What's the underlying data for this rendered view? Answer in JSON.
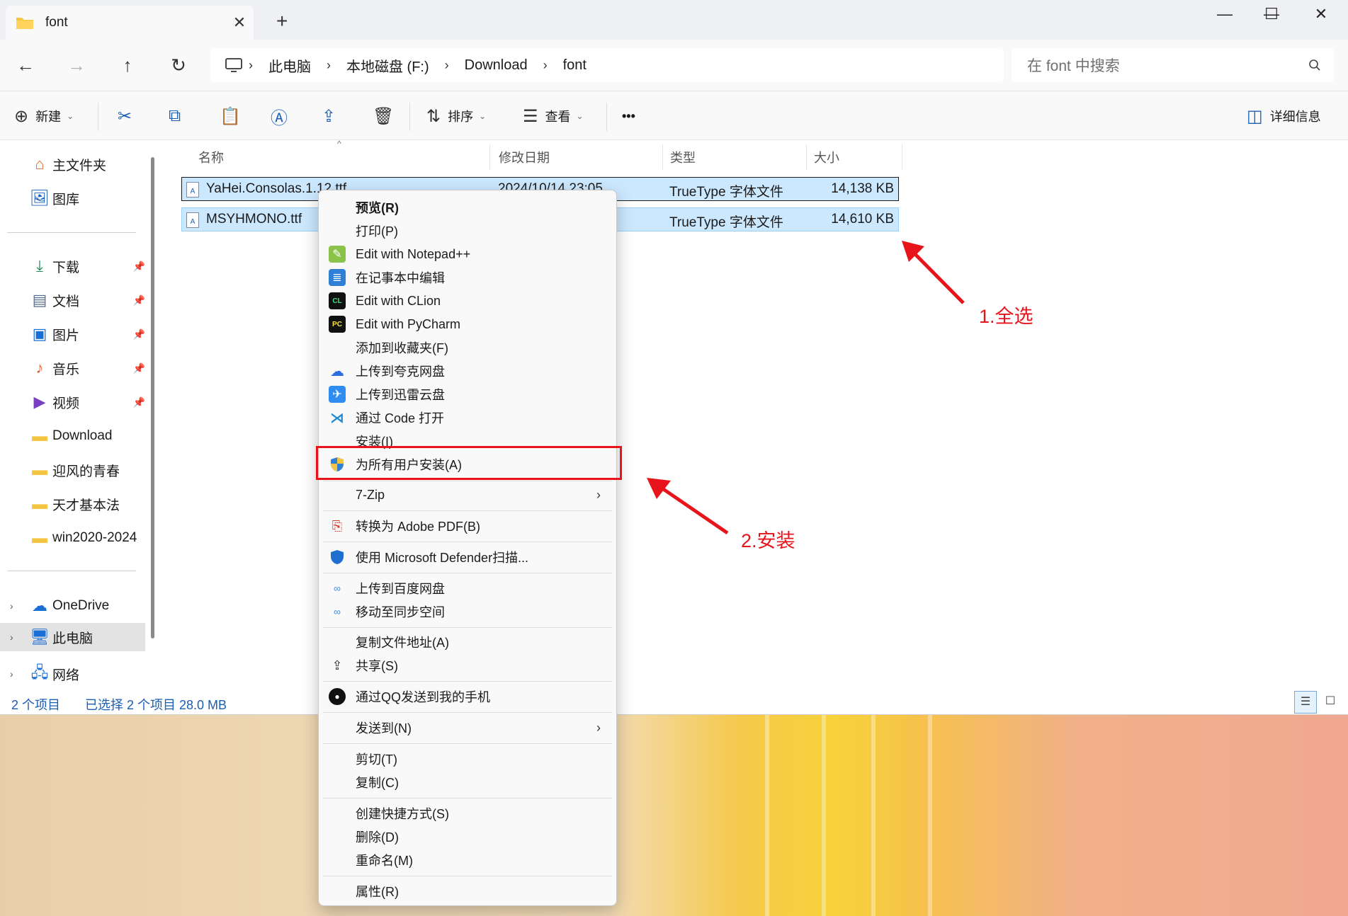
{
  "window": {
    "tab_title": "font",
    "tab_close": "✕",
    "new_tab": "+",
    "controls": {
      "minimize": "—",
      "maximize": "☐",
      "close": "✕"
    }
  },
  "nav": {
    "back": "←",
    "forward": "→",
    "up": "↑",
    "refresh": "↻"
  },
  "breadcrumb": [
    "此电脑",
    "本地磁盘 (F:)",
    "Download",
    "font"
  ],
  "search": {
    "placeholder": "在 font 中搜索"
  },
  "toolbar": {
    "new": "新建",
    "sort": "排序",
    "view": "查看",
    "more": "•••",
    "details": "详细信息"
  },
  "sidebar": {
    "top": [
      {
        "label": "主文件夹",
        "icon": "home-icon"
      },
      {
        "label": "图库",
        "icon": "gallery-icon"
      }
    ],
    "pinned": [
      {
        "label": "下载",
        "icon": "download-icon"
      },
      {
        "label": "文档",
        "icon": "document-icon"
      },
      {
        "label": "图片",
        "icon": "picture-icon"
      },
      {
        "label": "音乐",
        "icon": "music-icon"
      },
      {
        "label": "视频",
        "icon": "video-icon"
      },
      {
        "label": "Download",
        "icon": "folder-icon"
      },
      {
        "label": "迎风的青春",
        "icon": "folder-icon"
      },
      {
        "label": "天才基本法",
        "icon": "folder-icon"
      },
      {
        "label": "win2020-2024",
        "icon": "folder-icon"
      }
    ],
    "bottom": [
      {
        "label": "OneDrive",
        "icon": "cloud-icon"
      },
      {
        "label": "此电脑",
        "icon": "computer-icon"
      },
      {
        "label": "网络",
        "icon": "network-icon"
      }
    ]
  },
  "columns": {
    "name": "名称",
    "date": "修改日期",
    "type": "类型",
    "size": "大小"
  },
  "files": [
    {
      "name": "YaHei.Consolas.1.12.ttf",
      "date": "2024/10/14 23:05",
      "type": "TrueType 字体文件",
      "size": "14,138 KB"
    },
    {
      "name": "MSYHMONO.ttf",
      "date": "",
      "type": "TrueType 字体文件",
      "size": "14,610 KB"
    }
  ],
  "status": {
    "count": "2 个项目",
    "selected": "已选择 2 个项目  28.0 MB"
  },
  "context_menu": [
    {
      "label": "预览(R)",
      "bold": true
    },
    {
      "label": "打印(P)"
    },
    {
      "label": "Edit with Notepad++",
      "icon": "notepadpp-icon"
    },
    {
      "label": "在记事本中编辑",
      "icon": "notepad-icon"
    },
    {
      "label": "Edit with CLion",
      "icon": "clion-icon"
    },
    {
      "label": "Edit with PyCharm",
      "icon": "pycharm-icon"
    },
    {
      "label": "添加到收藏夹(F)"
    },
    {
      "label": "上传到夸克网盘",
      "icon": "quark-icon"
    },
    {
      "label": "上传到迅雷云盘",
      "icon": "xunlei-icon"
    },
    {
      "label": "通过 Code 打开",
      "icon": "vscode-icon"
    },
    {
      "label": "安装(I)"
    },
    {
      "label": "为所有用户安装(A)",
      "icon": "uac-shield-icon"
    },
    {
      "label": "7-Zip",
      "submenu": true
    },
    {
      "label": "转换为 Adobe PDF(B)",
      "icon": "adobe-pdf-icon"
    },
    {
      "label": "使用 Microsoft Defender扫描...",
      "icon": "defender-icon"
    },
    {
      "label": "上传到百度网盘",
      "icon": "baidu-icon"
    },
    {
      "label": "移动至同步空间",
      "icon": "baidu-icon"
    },
    {
      "label": "复制文件地址(A)"
    },
    {
      "label": "共享(S)",
      "icon": "share-icon"
    },
    {
      "label": "通过QQ发送到我的手机",
      "icon": "qq-icon"
    },
    {
      "label": "发送到(N)",
      "submenu": true
    },
    {
      "label": "剪切(T)"
    },
    {
      "label": "复制(C)"
    },
    {
      "label": "创建快捷方式(S)"
    },
    {
      "label": "删除(D)"
    },
    {
      "label": "重命名(M)"
    },
    {
      "label": "属性(R)"
    }
  ],
  "annotations": {
    "step1": "1.全选",
    "step2": "2.安装"
  },
  "colors": {
    "annotation_red": "#e8141c",
    "selection_blue": "#cce8ff",
    "accent": "#1a5fb4"
  }
}
